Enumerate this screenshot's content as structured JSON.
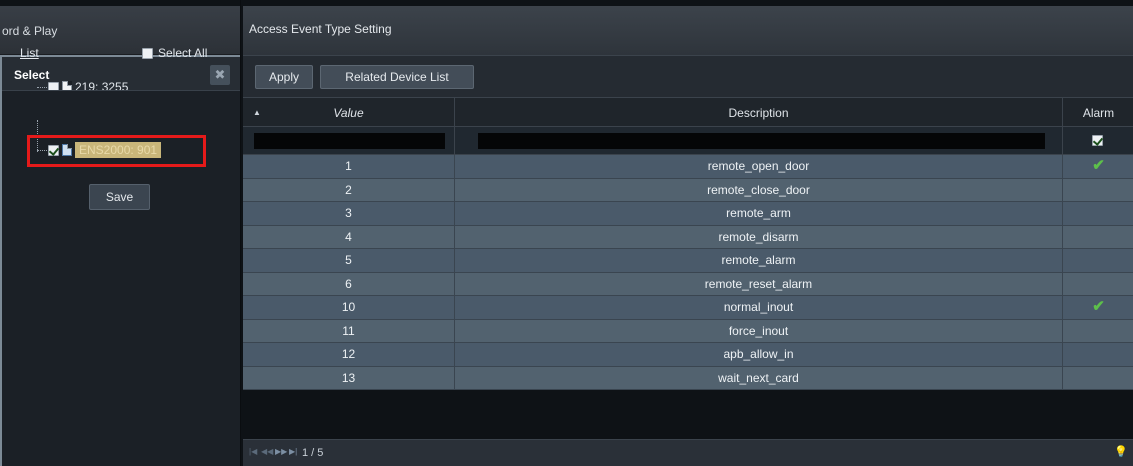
{
  "left_header": {
    "title": "ord & Play"
  },
  "select_panel": {
    "title": "Select",
    "close_icon": "close-icon",
    "list_label": "List",
    "select_all_label": "Select All",
    "tree_items": [
      {
        "label": "219: 3255",
        "checked": false
      },
      {
        "label": "ENS2000: 901",
        "checked": true
      }
    ],
    "save_label": "Save"
  },
  "main": {
    "title": "Access Event Type Setting",
    "toolbar": {
      "apply_label": "Apply",
      "related_label": "Related Device List"
    },
    "columns": {
      "value": "Value",
      "description": "Description",
      "alarm": "Alarm"
    },
    "rows": [
      {
        "value": "1",
        "description": "remote_open_door",
        "alarm": "✔"
      },
      {
        "value": "2",
        "description": "remote_close_door",
        "alarm": ""
      },
      {
        "value": "3",
        "description": "remote_arm",
        "alarm": ""
      },
      {
        "value": "4",
        "description": "remote_disarm",
        "alarm": ""
      },
      {
        "value": "5",
        "description": "remote_alarm",
        "alarm": ""
      },
      {
        "value": "6",
        "description": "remote_reset_alarm",
        "alarm": ""
      },
      {
        "value": "10",
        "description": "normal_inout",
        "alarm": "✔"
      },
      {
        "value": "11",
        "description": "force_inout",
        "alarm": ""
      },
      {
        "value": "12",
        "description": "apb_allow_in",
        "alarm": ""
      },
      {
        "value": "13",
        "description": "wait_next_card",
        "alarm": ""
      }
    ],
    "pager": {
      "page_text": "1 / 5"
    }
  },
  "colors": {
    "highlight": "#e51a1a",
    "check": "#5dc04a"
  }
}
